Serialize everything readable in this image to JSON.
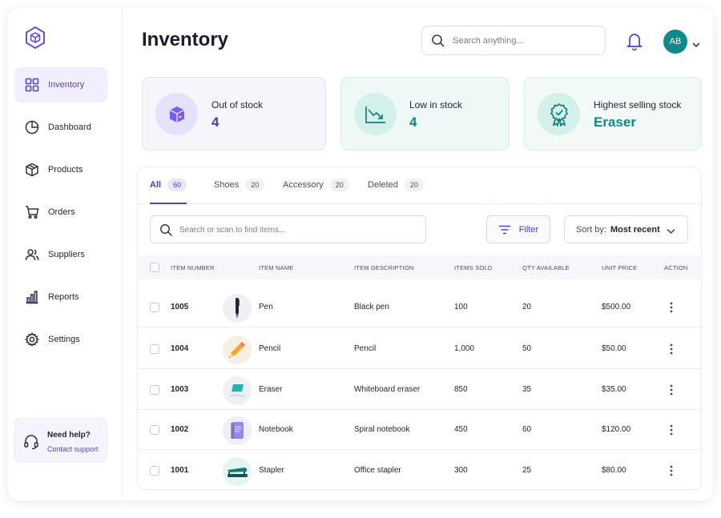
{
  "sidebar": {
    "logo_icon": "cube-hexagon-logo",
    "items": [
      {
        "label": "Inventory",
        "icon": "grid-icon",
        "active": true
      },
      {
        "label": "Dashboard",
        "icon": "pie-chart-icon"
      },
      {
        "label": "Products",
        "icon": "box-icon"
      },
      {
        "label": "Orders",
        "icon": "cart-icon"
      },
      {
        "label": "Suppliers",
        "icon": "users-icon"
      },
      {
        "label": "Reports",
        "icon": "bar-chart-icon"
      },
      {
        "label": "Settings",
        "icon": "gear-icon"
      }
    ],
    "help": {
      "title": "Need help?",
      "link": "Contact support",
      "icon": "headset-icon"
    }
  },
  "header": {
    "title": "Inventory",
    "search_placeholder": "Search anything...",
    "avatar_initials": "AB"
  },
  "stats": [
    {
      "label": "Out of stock",
      "value": "4",
      "icon": "box-icon"
    },
    {
      "label": "Low in stock",
      "value": "4",
      "icon": "trending-down-icon"
    },
    {
      "label": "Highest selling stock",
      "value": "Eraser",
      "icon": "award-badge-icon"
    }
  ],
  "tabs": [
    {
      "label": "All",
      "count": "60",
      "active": true
    },
    {
      "label": "Shoes",
      "count": "20"
    },
    {
      "label": "Accessory",
      "count": "20"
    },
    {
      "label": "Deleted",
      "count": "20"
    }
  ],
  "toolbar": {
    "search_placeholder": "Search or scan to find items...",
    "filter_label": "Filter",
    "sort_label": "Sort by:",
    "sort_value": "Most recent"
  },
  "table": {
    "columns": [
      "ITEM NUMBER",
      "ITEM NAME",
      "ITEM DESCRIPTION",
      "ITEMS SOLD",
      "QTY AVAILABLE",
      "UNIT PRICE",
      "ACTION"
    ],
    "rows": [
      {
        "number": "1005",
        "name": "Pen",
        "description": "Black pen",
        "sold": "100",
        "qty": "20",
        "price": "$500.00",
        "thumb": "pen"
      },
      {
        "number": "1004",
        "name": "Pencil",
        "description": "Pencil",
        "sold": "1,000",
        "qty": "50",
        "price": "$50.00",
        "thumb": "pencil"
      },
      {
        "number": "1003",
        "name": "Eraser",
        "description": "Whiteboard eraser",
        "sold": "850",
        "qty": "35",
        "price": "$35.00",
        "thumb": "eraser"
      },
      {
        "number": "1002",
        "name": "Notebook",
        "description": "Spiral notebook",
        "sold": "450",
        "qty": "60",
        "price": "$120.00",
        "thumb": "notebook"
      },
      {
        "number": "1001",
        "name": "Stapler",
        "description": "Office stapler",
        "sold": "300",
        "qty": "25",
        "price": "$80.00",
        "thumb": "stapler"
      }
    ]
  },
  "colors": {
    "accent": "#5a3fd0",
    "teal": "#0c8b8a",
    "active_nav_bg": "#f1efff"
  }
}
